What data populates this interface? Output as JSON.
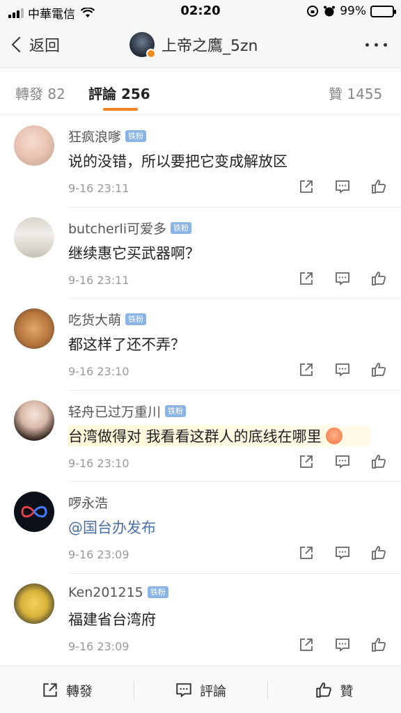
{
  "status_bar": {
    "carrier": "中華電信",
    "time": "02:20",
    "battery": "99%",
    "battery_level": 0.99
  },
  "nav": {
    "back_label": "返回",
    "title": "上帝之鷹_5zn"
  },
  "tabs": [
    {
      "label": "轉發 82",
      "active": false
    },
    {
      "label": "評論 256",
      "active": true
    },
    {
      "label": "贊 1455",
      "active": false
    }
  ],
  "comments": [
    {
      "name": "狂疯浪嗲",
      "badge": "铁粉",
      "text": "说的没错，所以要把它变成解放区",
      "time": "9-16 23:11"
    },
    {
      "name": "butcherli可爱多",
      "badge": "铁粉",
      "text": "继续惠它买武器啊？",
      "time": "9-16 23:11"
    },
    {
      "name": "吃货大萌",
      "badge": "铁粉",
      "text": "都这样了还不弄？",
      "time": "9-16 23:10"
    },
    {
      "name": "轻舟已过万重川",
      "badge": "铁粉",
      "text": "台湾做得对 我看看这群人的底线在哪里",
      "time": "9-16 23:10"
    },
    {
      "name": "啰永浩",
      "badge": "",
      "text": "@国台办发布",
      "time": "9-16 23:09"
    },
    {
      "name": "Ken201215",
      "badge": "铁粉",
      "text": "福建省台湾府",
      "time": "9-16 23:09"
    }
  ],
  "toolbar": {
    "repost": "轉發",
    "comment": "評論",
    "like": "贊"
  },
  "colors": {
    "accent": "#f5821f",
    "badge": "#8ab4e6",
    "link": "#4a6fa5"
  }
}
